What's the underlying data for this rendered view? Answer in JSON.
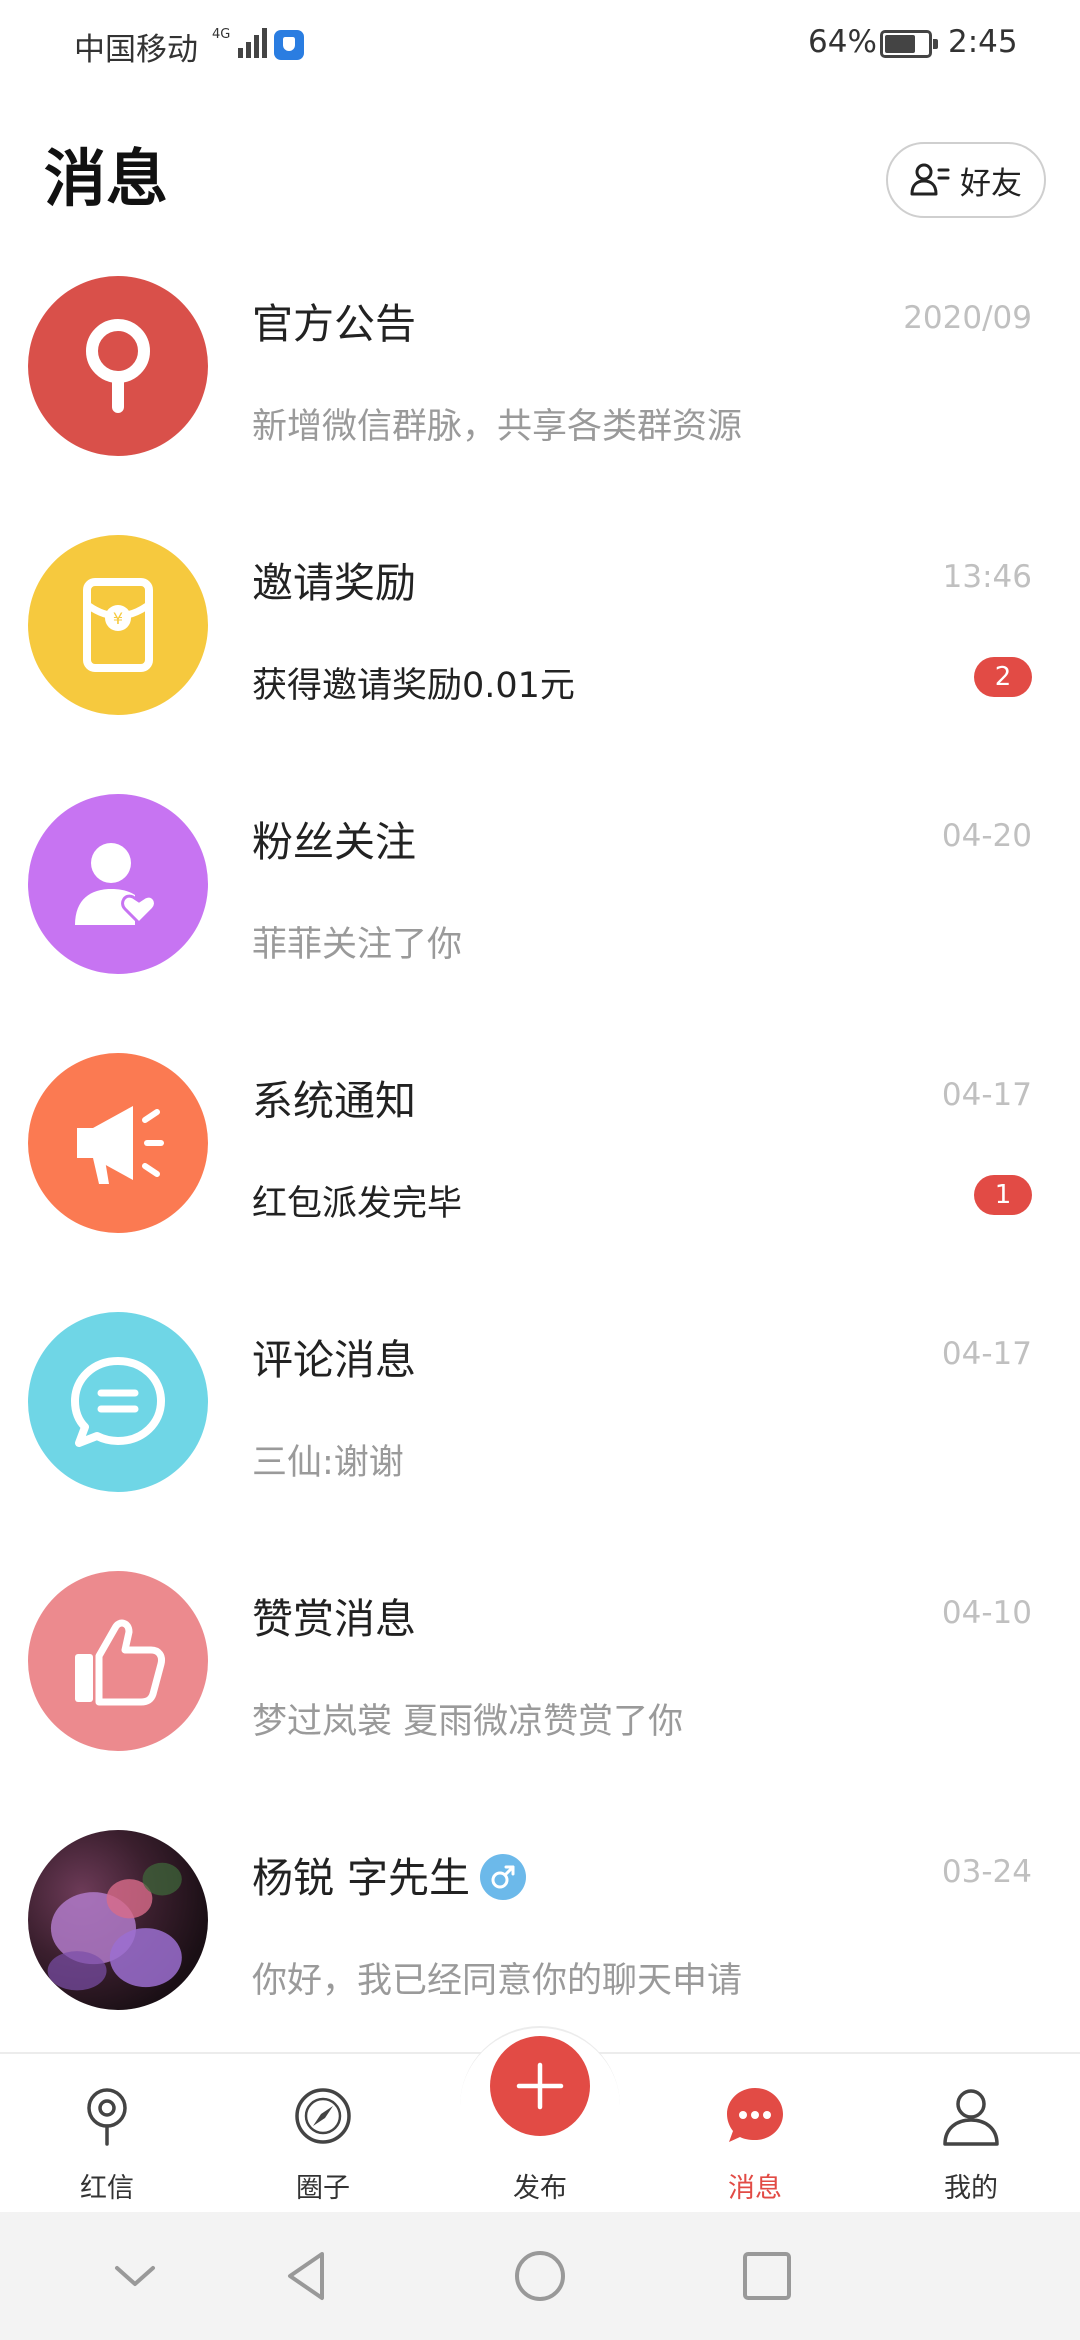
{
  "status_bar": {
    "carrier": "中国移动",
    "network": "4G",
    "battery": "64%",
    "time": "2:45"
  },
  "header": {
    "title": "消息",
    "friends_label": "好友"
  },
  "messages": [
    {
      "title": "官方公告",
      "time": "2020/09",
      "preview": "新增微信群脉，共享各类群资源",
      "badge": "",
      "icon": "pin-icon",
      "color": "#d9504a"
    },
    {
      "title": "邀请奖励",
      "time": "13:46",
      "preview": "获得邀请奖励0.01元",
      "badge": "2",
      "icon": "red-envelope-icon",
      "color": "#f6c93e"
    },
    {
      "title": "粉丝关注",
      "time": "04-20",
      "preview": "菲菲关注了你",
      "badge": "",
      "icon": "fan-heart-icon",
      "color": "#c774f2"
    },
    {
      "title": "系统通知",
      "time": "04-17",
      "preview": "红包派发完毕",
      "badge": "1",
      "icon": "megaphone-icon",
      "color": "#fb7a52"
    },
    {
      "title": "评论消息",
      "time": "04-17",
      "preview": "三仙:谢谢",
      "badge": "",
      "icon": "comment-icon",
      "color": "#6fd6e6"
    },
    {
      "title": "赞赏消息",
      "time": "04-10",
      "preview": "梦过岚裳 夏雨微凉赞赏了你",
      "badge": "",
      "icon": "thumbs-up-icon",
      "color": "#ec8a8e"
    },
    {
      "title": "杨锐 字先生",
      "time": "03-24",
      "preview": "你好，我已经同意你的聊天申请",
      "badge": "",
      "icon": "male-icon",
      "color": "#6cb9ea"
    }
  ],
  "tabs": [
    {
      "label": "红信",
      "icon": "pin-icon"
    },
    {
      "label": "圈子",
      "icon": "compass-icon"
    },
    {
      "label": "发布",
      "icon": "plus-icon"
    },
    {
      "label": "消息",
      "icon": "chat-bubble-icon",
      "active": true
    },
    {
      "label": "我的",
      "icon": "user-icon"
    }
  ],
  "colors": {
    "accent": "#e24b45",
    "muted_text": "#9a9a9a",
    "time_text": "#c0c0c0"
  }
}
